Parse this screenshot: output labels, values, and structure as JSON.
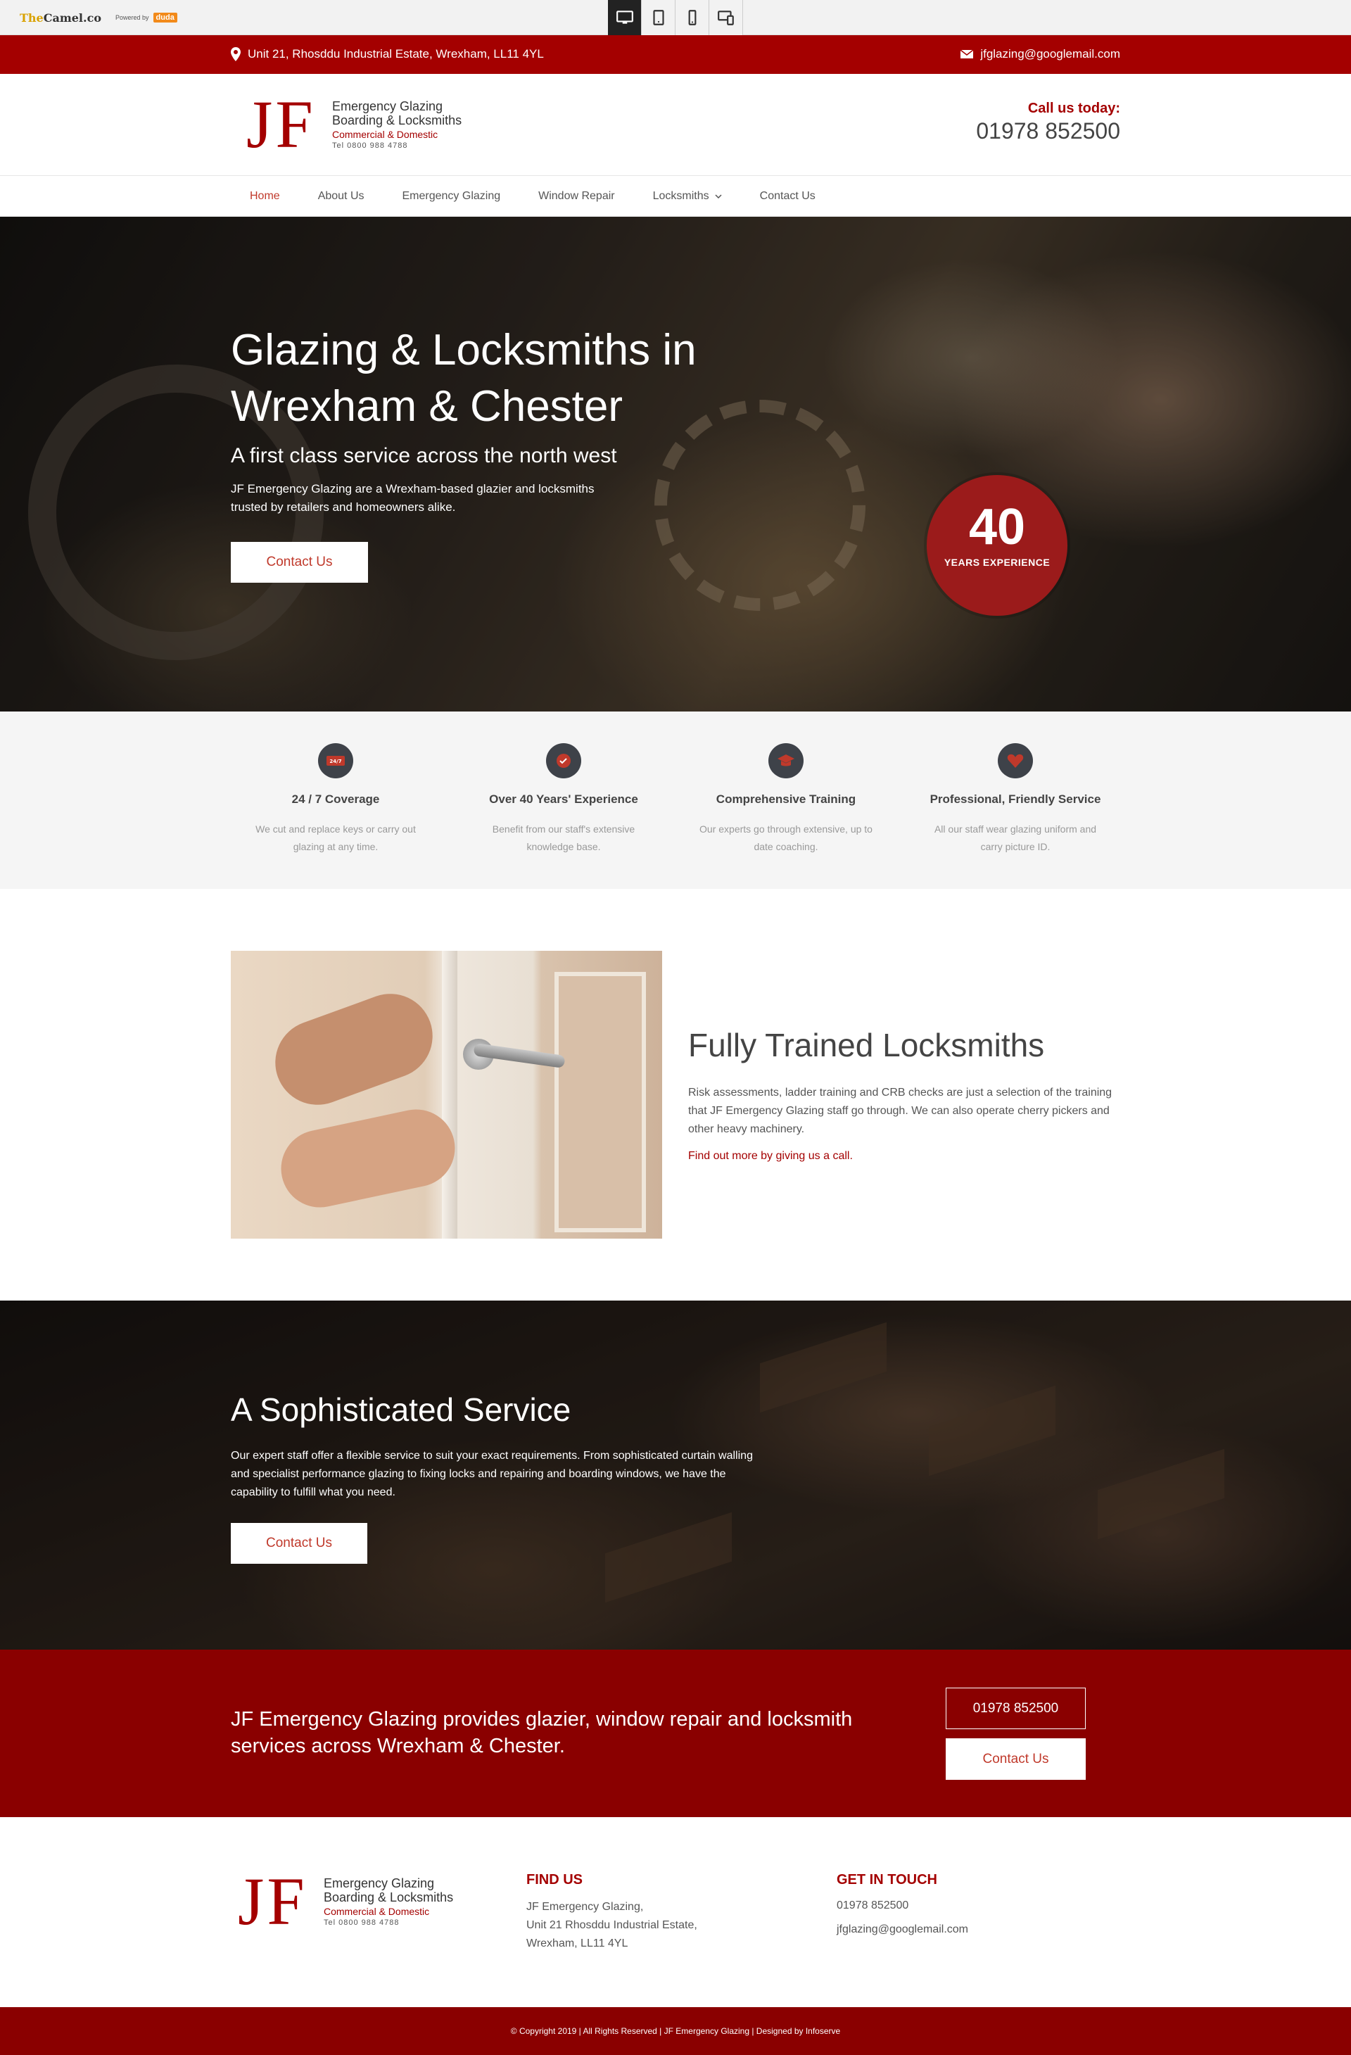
{
  "editor": {
    "brand_left": "The",
    "brand_right": "Camel.co",
    "powered_by": "Powered by",
    "duda": "duda",
    "devices": [
      "desktop-icon",
      "tablet-icon",
      "mobile-icon",
      "responsive-icon"
    ]
  },
  "topbar": {
    "address": "Unit 21, Rhosddu Industrial Estate, Wrexham, LL11 4YL",
    "email": "jfglazing@googlemail.com"
  },
  "logo": {
    "mark": "JF",
    "line1": "Emergency Glazing",
    "line2": "Boarding & Locksmiths",
    "line3": "Commercial & Domestic",
    "line4": "Tel 0800 988 4788"
  },
  "header": {
    "call_label": "Call us today:",
    "phone": "01978 852500"
  },
  "nav": {
    "items": [
      "Home",
      "About Us",
      "Emergency Glazing",
      "Window Repair",
      "Locksmiths",
      "Contact Us"
    ]
  },
  "hero": {
    "title": "Glazing & Locksmiths in Wrexham & Chester",
    "subtitle": "A first class service across the north west",
    "text": "JF Emergency Glazing are a Wrexham-based glazier and locksmiths trusted by retailers and homeowners alike.",
    "cta": "Contact Us",
    "badge_number": "40",
    "badge_text": "YEARS EXPERIENCE"
  },
  "features": [
    {
      "icon": "24-7-icon",
      "title": "24 / 7 Coverage",
      "text": "We cut and replace keys or carry out glazing at any time."
    },
    {
      "icon": "checkmark-badge-icon",
      "title": "Over 40 Years' Experience",
      "text": "Benefit from our staff's extensive knowledge base."
    },
    {
      "icon": "graduation-cap-icon",
      "title": "Comprehensive Training",
      "text": "Our experts go through extensive, up to date coaching."
    },
    {
      "icon": "heart-icon",
      "title": "Professional, Friendly Service",
      "text": "All our staff wear glazing uniform and carry picture ID."
    }
  ],
  "locksmiths": {
    "title": "Fully Trained Locksmiths",
    "text": "Risk assessments, ladder training and CRB checks are just a selection of the training that JF Emergency Glazing staff go through. We can also operate cherry pickers and other heavy machinery.",
    "link": "Find out more by giving us a call."
  },
  "sophisticated": {
    "title": "A Sophisticated Service",
    "text": "Our expert staff offer a flexible service to suit your exact requirements. From sophisticated curtain walling and specialist performance glazing to fixing locks and repairing and boarding windows, we have the capability to fulfill what you need.",
    "cta": "Contact Us"
  },
  "band": {
    "message": "JF Emergency Glazing provides glazier, window repair and locksmith services across Wrexham & Chester.",
    "phone_button": "01978 852500",
    "cta": "Contact Us"
  },
  "footer": {
    "find_title": "FIND US",
    "find_lines": [
      "JF Emergency Glazing,",
      "Unit 21 Rhosddu Industrial Estate,",
      "Wrexham, LL11 4YL"
    ],
    "touch_title": "GET IN TOUCH",
    "touch_phone": "01978 852500",
    "touch_email": "jfglazing@googlemail.com"
  },
  "copyright": "© Copyright 2019 | All Rights Reserved | JF Emergency Glazing | Designed by Infoserve",
  "colors": {
    "brand_red": "#a40000",
    "band_red": "#8a0000",
    "nav_active": "#c0392b",
    "icon_bg": "#3e4249"
  }
}
